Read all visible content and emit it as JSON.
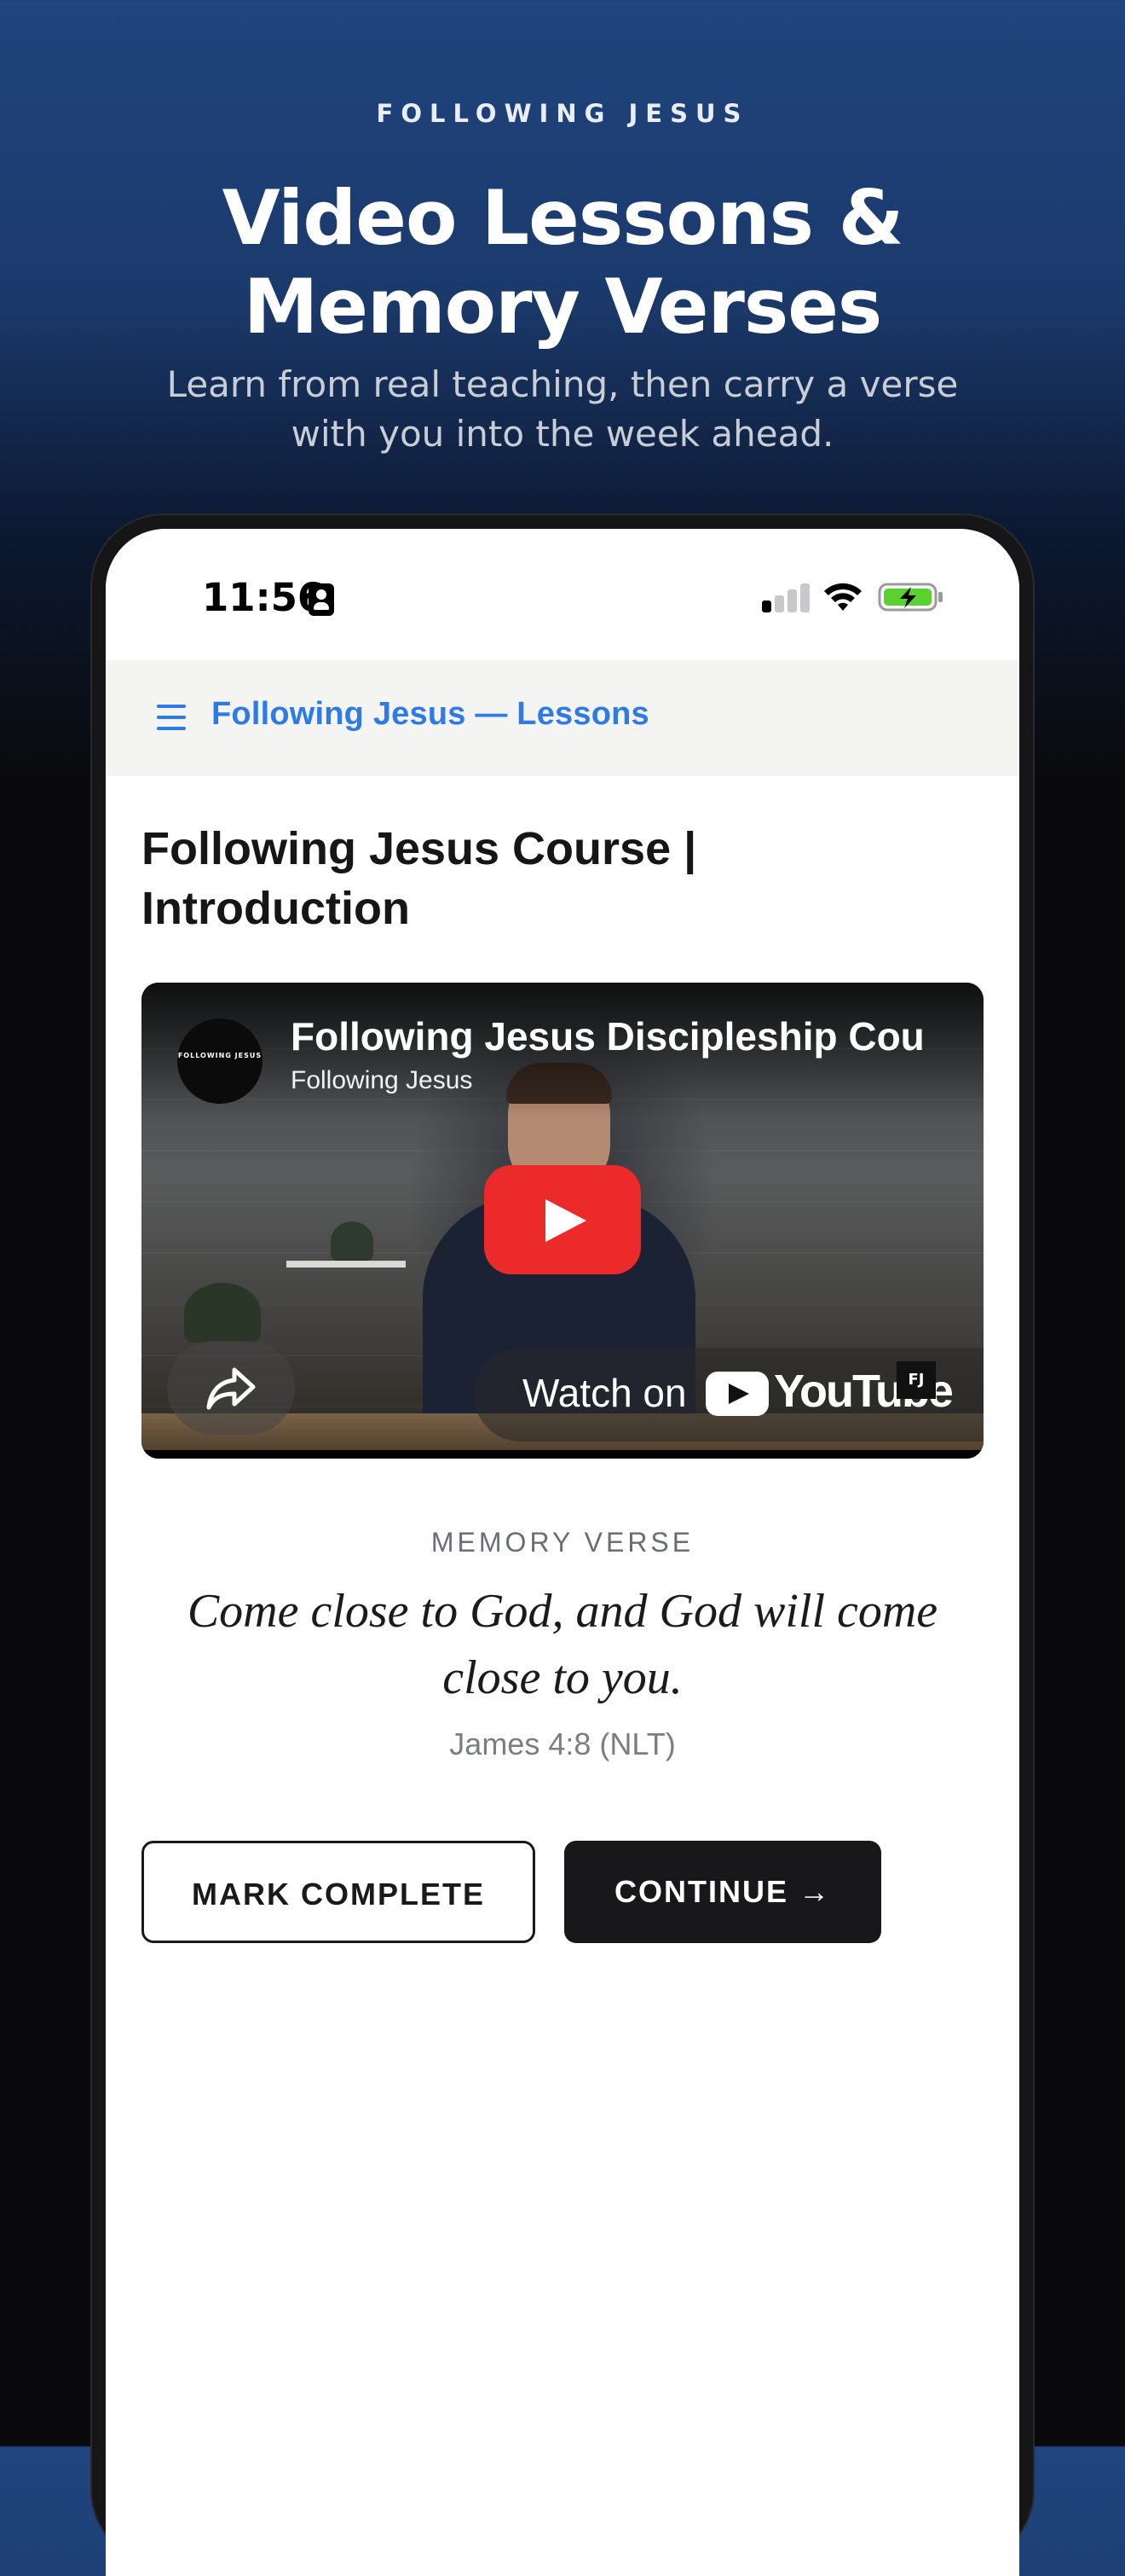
{
  "hero": {
    "eyebrow": "FOLLOWING JESUS",
    "headline_line1": "Video Lessons &",
    "headline_line2": "Memory Verses",
    "subhead": "Learn from real teaching, then carry a verse with you into the week ahead."
  },
  "statusbar": {
    "time": "11:56",
    "icons": [
      "contact-card-icon",
      "signal-icon",
      "wifi-icon",
      "battery-charging-icon"
    ]
  },
  "appbar": {
    "menu_icon": "hamburger-menu-icon",
    "title": "Following Jesus — Lessons",
    "accent_color": "#2e7be5"
  },
  "lesson": {
    "title": "Following Jesus Course | Introduction"
  },
  "video": {
    "title": "Following Jesus Discipleship Cou",
    "channel": "Following Jesus",
    "channel_logo_text": "FOLLOWING JESUS",
    "watch_on": "Watch on",
    "provider": "YouTube",
    "badge": "FJ",
    "play_color": "#ec2a2a"
  },
  "memory_verse": {
    "label": "MEMORY VERSE",
    "text": "Come close to God, and God will come close to you.",
    "reference": "James 4:8 (NLT)"
  },
  "actions": {
    "mark_complete": "MARK COMPLETE",
    "continue": "CONTINUE →"
  }
}
